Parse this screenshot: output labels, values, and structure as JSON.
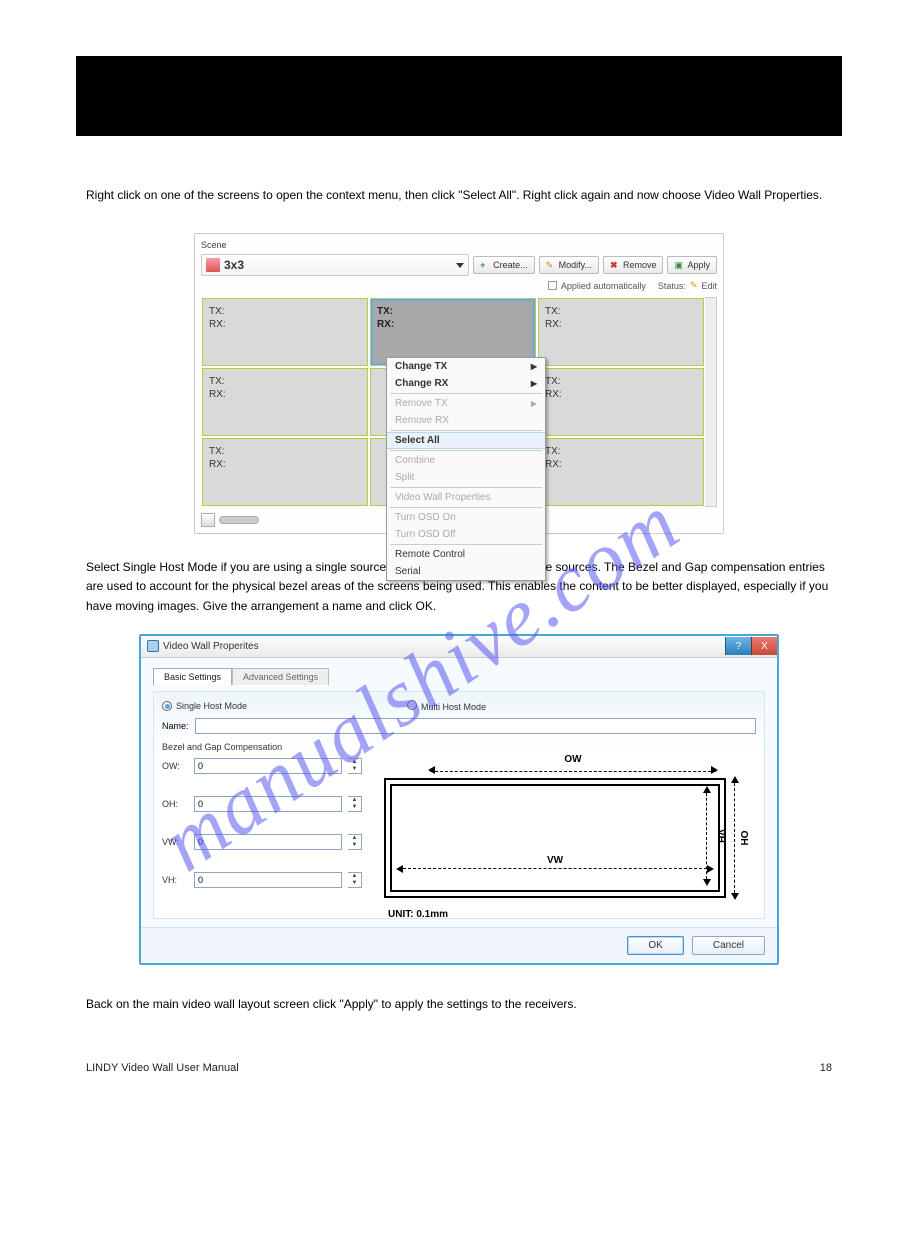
{
  "topbar": {},
  "watermark": "manualshive.com",
  "para1": "Right click on one of the screens to open the context menu, then click \"Select All\". Right click again and now choose Video Wall Properties.",
  "para2": "Select Single Host Mode if you are using a single source or Multi Host Mode for multiple sources. The Bezel and Gap compensation entries are used to account for the physical bezel areas of the screens being used. This enables the content to be better displayed, especially if you have moving images. Give the arrangement a name and click OK.",
  "para3": "Back on the main video wall layout screen click \"Apply\" to apply the settings to the receivers.",
  "figure1": {
    "scene_label": "Scene",
    "dropdown": "3x3",
    "btn_create": "Create...",
    "btn_modify": "Modify...",
    "btn_remove": "Remove",
    "btn_apply": "Apply",
    "applied_auto": "Applied automatically",
    "status_label": "Status:",
    "status_value": "Edit",
    "tile_tx": "TX:",
    "tile_rx": "RX:",
    "context": {
      "change_tx": "Change TX",
      "change_rx": "Change RX",
      "remove_tx": "Remove TX",
      "remove_rx": "Remove RX",
      "select_all": "Select All",
      "combine": "Combine",
      "split": "Split",
      "vw_props": "Video Wall Properties",
      "osd_on": "Turn OSD On",
      "osd_off": "Turn OSD Off",
      "remote": "Remote Control",
      "serial": "Serial"
    }
  },
  "figure2": {
    "title": "Video Wall Properites",
    "tab_basic": "Basic Settings",
    "tab_adv": "Advanced Settings",
    "mode_single": "Single Host Mode",
    "mode_multi": "Multi Host Mode",
    "name_label": "Name:",
    "name_value": "",
    "section_title": "Bezel and Gap Compensation",
    "inputs": {
      "ow": {
        "label": "OW:",
        "value": "0"
      },
      "oh": {
        "label": "OH:",
        "value": "0"
      },
      "vw": {
        "label": "VW:",
        "value": "0"
      },
      "vh": {
        "label": "VH:",
        "value": "0"
      }
    },
    "diagram": {
      "ow": "OW",
      "oh": "OH",
      "vw": "VW",
      "vh": "VH",
      "unit": "UNIT: 0.1mm"
    },
    "btn_ok": "OK",
    "btn_cancel": "Cancel",
    "help": "?",
    "close": "X"
  },
  "footer": {
    "left": "LINDY Video Wall User Manual",
    "right": "18"
  }
}
